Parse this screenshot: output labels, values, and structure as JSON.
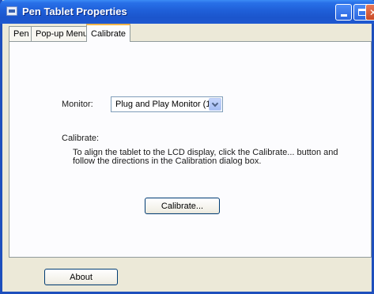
{
  "window": {
    "title": "Pen Tablet Properties"
  },
  "tabs": [
    {
      "label": "Pen"
    },
    {
      "label": "Pop-up Menu"
    },
    {
      "label": "Calibrate"
    }
  ],
  "calibrate_tab": {
    "monitor_label": "Monitor:",
    "monitor_value": "Plug and Play Monitor (1)",
    "section_label": "Calibrate:",
    "instruction_line1": "To align the tablet to the LCD display, click the Calibrate... button and",
    "instruction_line2": "follow the directions in the Calibration dialog box.",
    "calibrate_button": "Calibrate..."
  },
  "footer": {
    "about_button": "About"
  },
  "colors": {
    "titlebar": "#1f5fd8",
    "window_face": "#ece9d8",
    "active_tab_accent": "#f2b64b"
  },
  "icons": {
    "title": "tablet-app-icon",
    "minimize": "minimize-icon",
    "maximize": "maximize-icon",
    "close": "close-icon",
    "dropdown": "chevron-down-icon"
  }
}
